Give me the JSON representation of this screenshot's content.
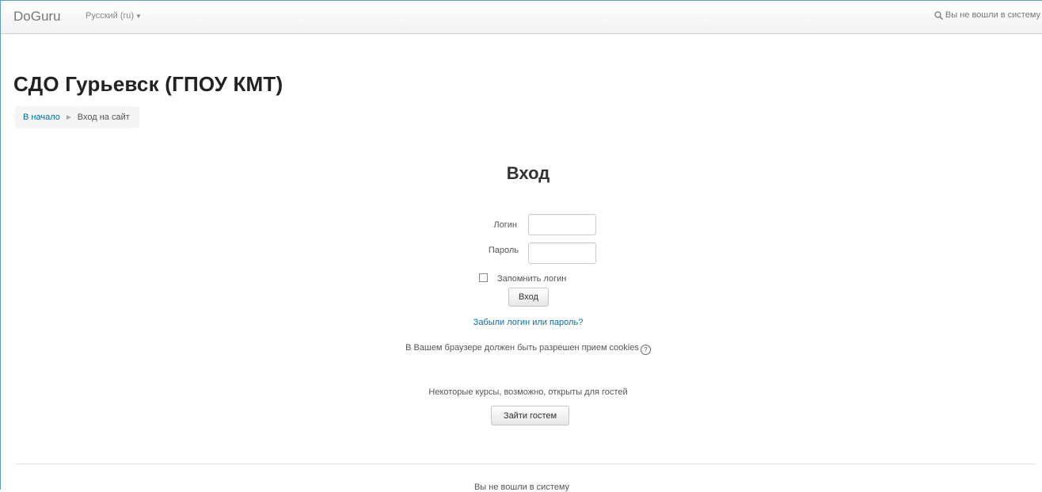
{
  "navbar": {
    "brand": "DoGuru",
    "language": "Русский (ru)",
    "login_status": "Вы не вошли в систему"
  },
  "header": {
    "title": "СДО Гурьевск (ГПОУ КМТ)"
  },
  "breadcrumb": {
    "home": "В начало",
    "current": "Вход на сайт",
    "separator": "►"
  },
  "login": {
    "title": "Вход",
    "username_label": "Логин",
    "password_label": "Пароль",
    "username_value": "",
    "password_value": "",
    "remember_label": "Запомнить логин",
    "remember_checked": false,
    "submit_label": "Вход",
    "forgot_link": "Забыли логин или пароль?",
    "cookies_notice": "В Вашем браузере должен быть разрешен прием cookies",
    "guest_notice": "Некоторые курсы, возможно, открыты для гостей",
    "guest_button": "Зайти гостем"
  },
  "footer": {
    "login_status": "Вы не вошли в систему"
  },
  "icons": {
    "search": "search-icon",
    "help": "help-icon",
    "caret": "caret-down-icon"
  },
  "colors": {
    "link": "#0070a8",
    "navbar_bg": "#f5f5f5"
  }
}
